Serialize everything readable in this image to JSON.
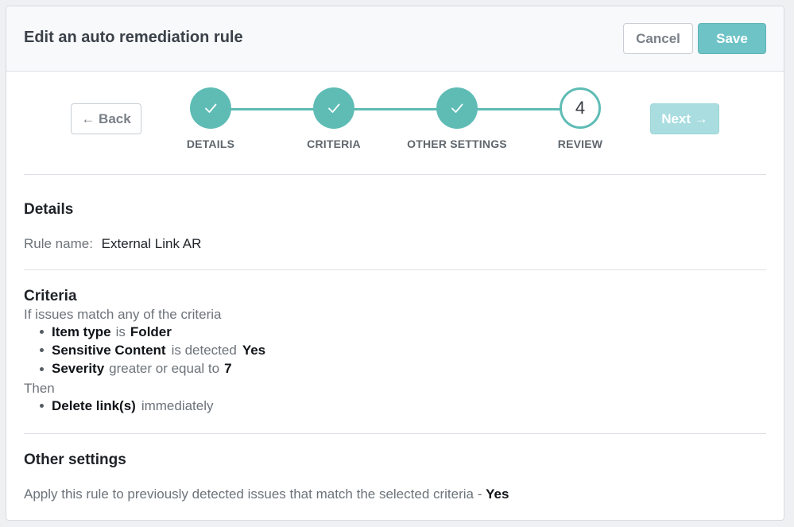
{
  "header": {
    "title": "Edit an auto remediation rule",
    "cancel_label": "Cancel",
    "save_label": "Save"
  },
  "stepper": {
    "back_label": "← Back",
    "next_label": "Next →",
    "steps": [
      {
        "label": "DETAILS",
        "status": "done",
        "glyph": "✓"
      },
      {
        "label": "CRITERIA",
        "status": "done",
        "glyph": "✓"
      },
      {
        "label": "OTHER SETTINGS",
        "status": "done",
        "glyph": "✓"
      },
      {
        "label": "REVIEW",
        "status": "current",
        "glyph": "4"
      }
    ]
  },
  "details": {
    "title": "Details",
    "rule_name_label": "Rule name:",
    "rule_name_value": "External Link AR"
  },
  "criteria": {
    "title": "Criteria",
    "intro": "If issues match any of the criteria",
    "conditions": [
      {
        "field": "Item type",
        "operator": "is",
        "value": "Folder"
      },
      {
        "field": "Sensitive Content",
        "operator": "is detected",
        "value": "Yes"
      },
      {
        "field": "Severity",
        "operator": "greater or equal to",
        "value": "7"
      }
    ],
    "then_label": "Then",
    "actions": [
      {
        "action": "Delete link(s)",
        "timing": "immediately"
      }
    ]
  },
  "other_settings": {
    "title": "Other settings",
    "apply_text": "Apply this rule to previously detected issues that match the selected criteria -",
    "apply_value": "Yes"
  },
  "colors": {
    "accent": "#5ebcb5",
    "save_button": "#6ec3c7",
    "next_button_disabled": "#a9dde0"
  }
}
